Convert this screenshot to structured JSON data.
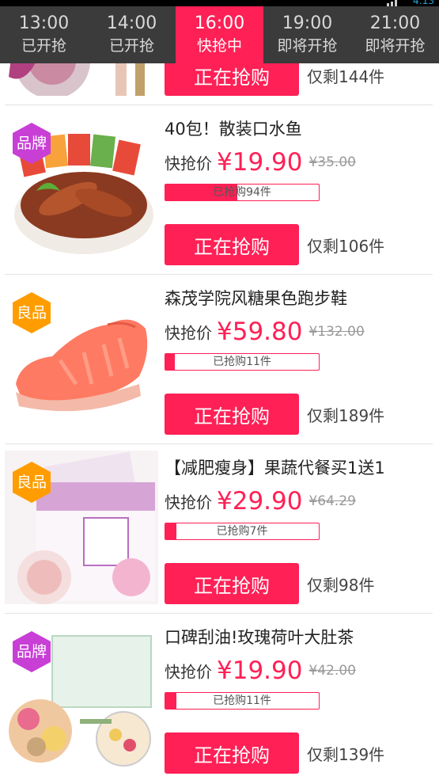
{
  "statusbar": {
    "time": "4:13"
  },
  "tabs": [
    {
      "time": "13:00",
      "status": "已开抢",
      "active": false
    },
    {
      "time": "14:00",
      "status": "已开抢",
      "active": false
    },
    {
      "time": "16:00",
      "status": "快抢中",
      "active": true
    },
    {
      "time": "19:00",
      "status": "即将开抢",
      "active": false
    },
    {
      "time": "21:00",
      "status": "即将开抢",
      "active": false
    }
  ],
  "colors": {
    "accent": "#ff2056",
    "tabbar": "#3b3b3b",
    "badge_brand": "#c83fd6",
    "badge_good": "#ff9d00"
  },
  "partial_item": {
    "button_label": "正在抢购",
    "remaining": "仅剩144件"
  },
  "items": [
    {
      "badge": "品牌",
      "badge_type": "brand",
      "title": "40包！散装口水鱼",
      "price_label": "快抢价",
      "price": "¥19.90",
      "original_price": "¥35.00",
      "sold_text": "已抢购94件",
      "sold_fraction": 0.47,
      "button_label": "正在抢购",
      "remaining": "仅剩106件",
      "image": "spicy-fish-snack"
    },
    {
      "badge": "良品",
      "badge_type": "good",
      "title": "森茂学院风糖果色跑步鞋",
      "price_label": "快抢价",
      "price": "¥59.80",
      "original_price": "¥132.00",
      "sold_text": "已抢购11件",
      "sold_fraction": 0.06,
      "button_label": "正在抢购",
      "remaining": "仅剩189件",
      "image": "coral-running-shoe"
    },
    {
      "badge": "良品",
      "badge_type": "good",
      "title": "【减肥瘦身】果蔬代餐买1送1",
      "price_label": "快抢价",
      "price": "¥29.90",
      "original_price": "¥64.29",
      "sold_text": "已抢购7件",
      "sold_fraction": 0.07,
      "button_label": "正在抢购",
      "remaining": "仅剩98件",
      "image": "meal-replacement-powder"
    },
    {
      "badge": "品牌",
      "badge_type": "brand",
      "title": "口碑刮油!玫瑰荷叶大肚茶",
      "price_label": "快抢价",
      "price": "¥19.90",
      "original_price": "¥42.00",
      "sold_text": "已抢购11件",
      "sold_fraction": 0.07,
      "button_label": "正在抢购",
      "remaining": "仅剩139件",
      "image": "rose-lotus-tea"
    }
  ]
}
